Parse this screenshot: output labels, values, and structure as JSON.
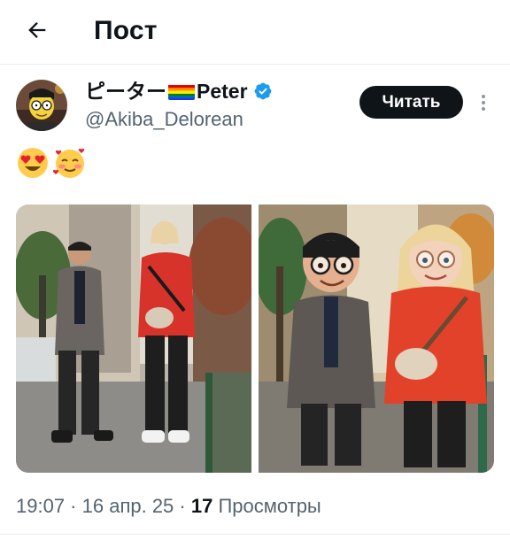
{
  "header": {
    "title": "Пост",
    "back_icon": "arrow-left-icon"
  },
  "author": {
    "name_prefix": "ピーター",
    "flag_icon": "rainbow-flag-icon",
    "name_suffix": "Peter",
    "verified_icon": "verified-badge-icon",
    "verified_color": "#1d9bf0",
    "handle": "@Akiba_Delorean",
    "follow_label": "Читать",
    "more_icon": "more-vertical-icon"
  },
  "post": {
    "text_emojis": [
      "😍",
      "🥰"
    ]
  },
  "meta": {
    "time": "19:07",
    "sep1": " · ",
    "date": "16 апр. 25",
    "sep2": " · ",
    "views_count": "17",
    "views_label": " Просмотры"
  },
  "colors": {
    "text": "#0f1419",
    "muted": "#536471",
    "divider": "#e6ecf0",
    "button_bg": "#0f1419"
  }
}
